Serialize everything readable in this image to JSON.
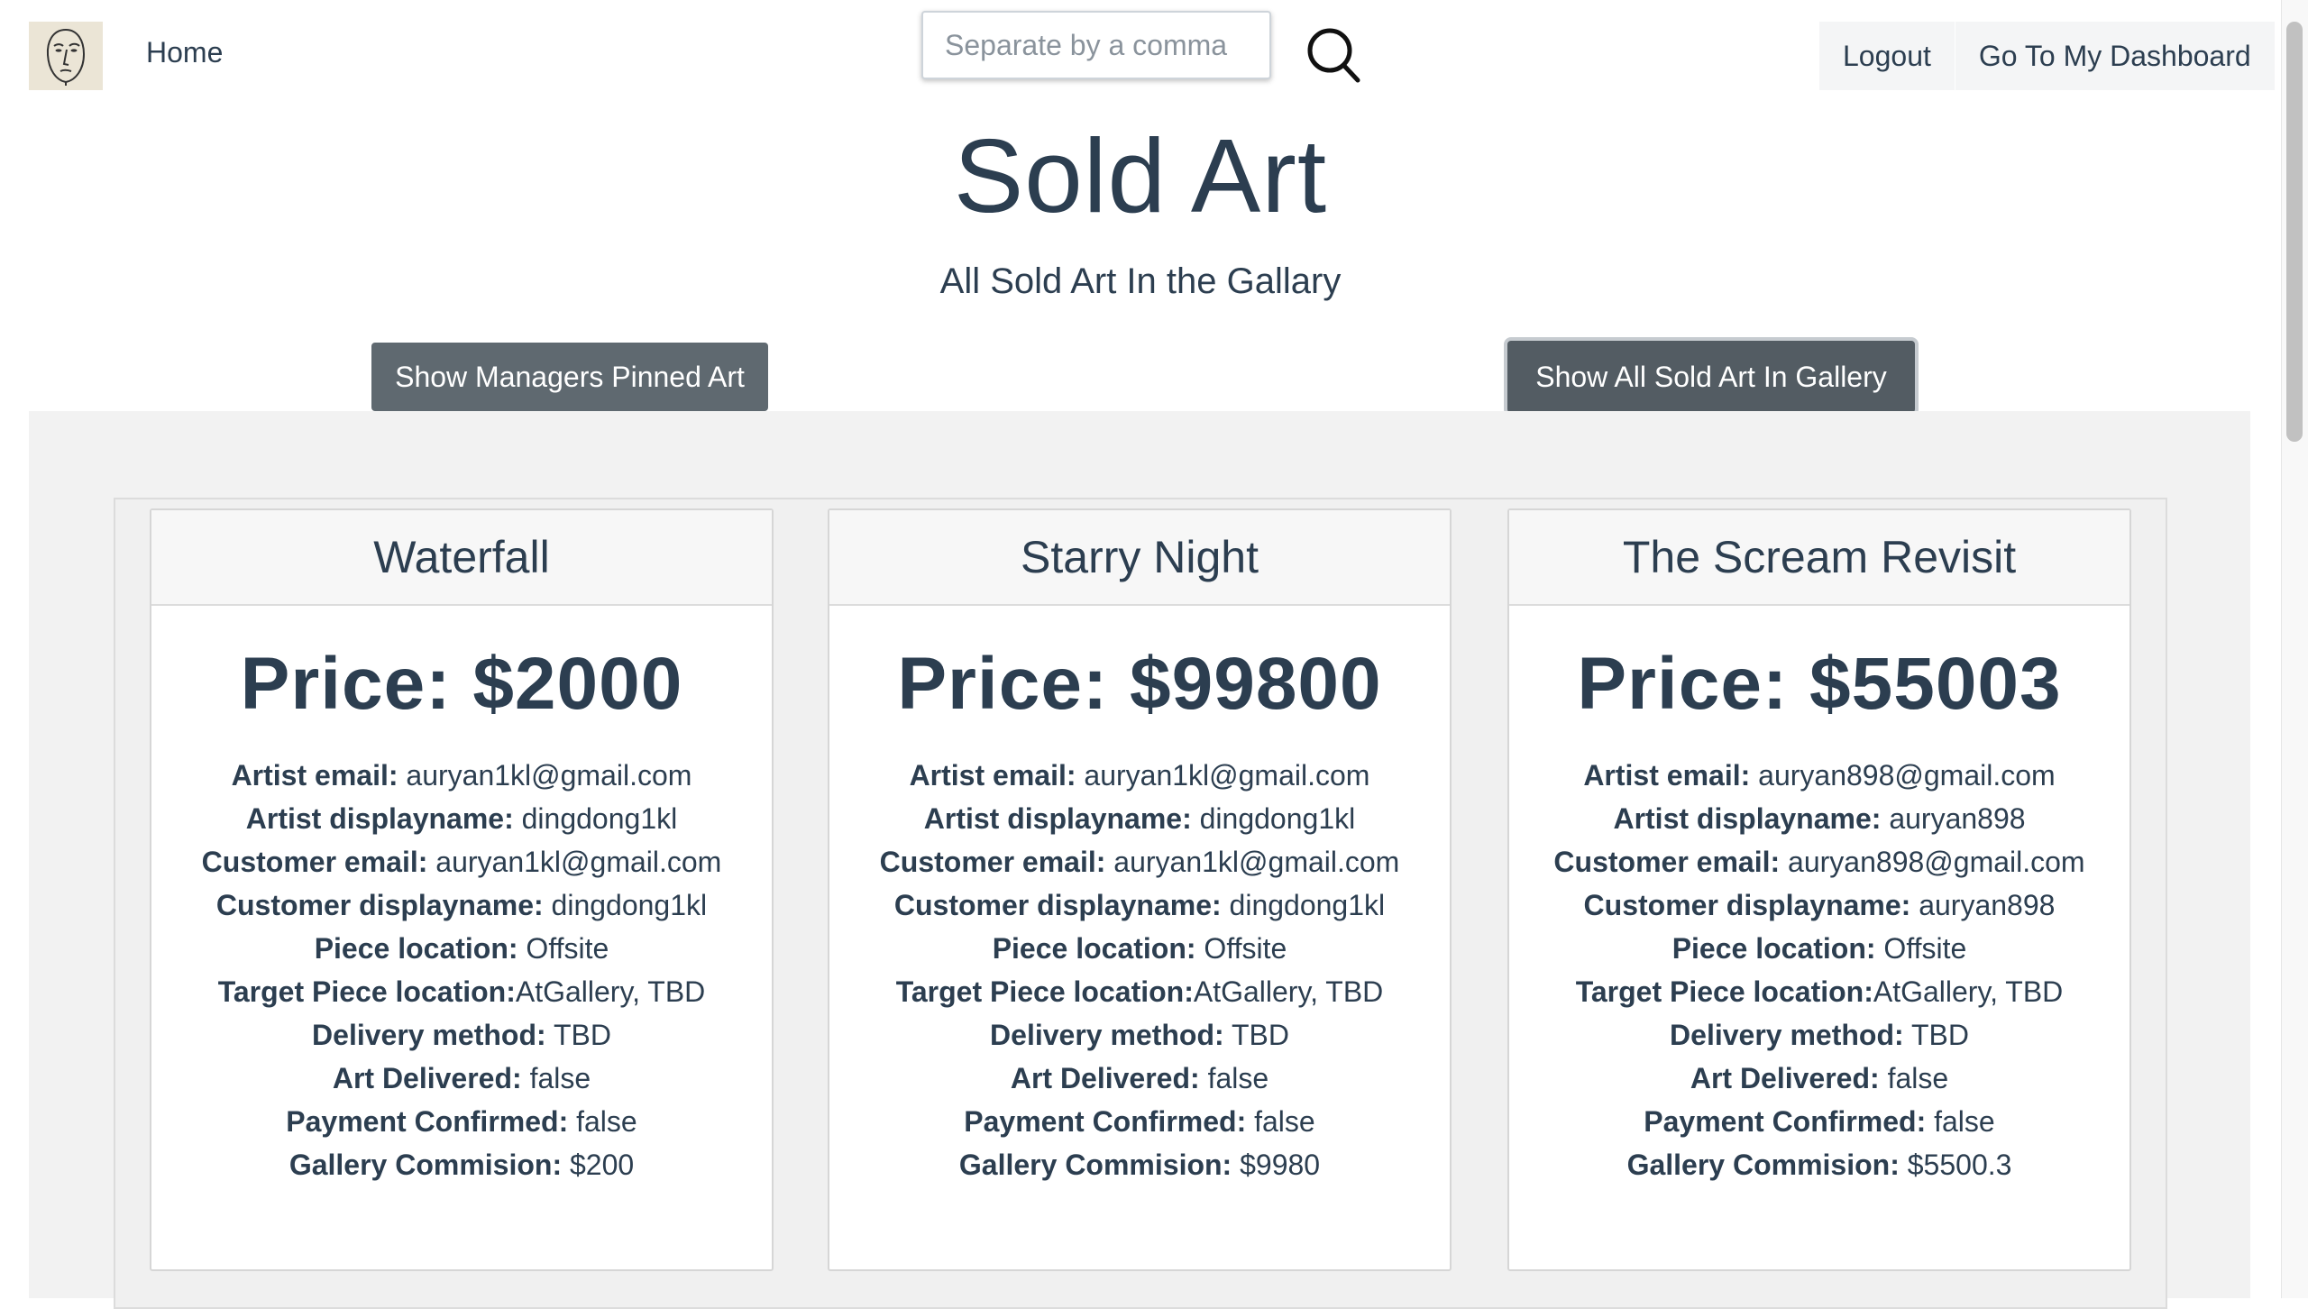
{
  "nav": {
    "home_label": "Home",
    "search_placeholder": "Separate by a comma",
    "logout_label": "Logout",
    "dashboard_label": "Go To My Dashboard"
  },
  "header": {
    "title": "Sold Art",
    "subtitle": "All Sold Art In the Gallary",
    "pinned_button": "Show Managers Pinned Art",
    "all_button": "Show All Sold Art In Gallery"
  },
  "labels": {
    "price_prefix": "Price: ",
    "artist_email": "Artist email:",
    "artist_displayname": "Artist displayname:",
    "customer_email": "Customer email:",
    "customer_displayname": "Customer displayname:",
    "piece_location": "Piece location:",
    "target_location": "Target Piece location:",
    "delivery_method": "Delivery method:",
    "art_delivered": "Art Delivered:",
    "payment_confirmed": "Payment Confirmed:",
    "gallery_commision": "Gallery Commision:"
  },
  "cards": [
    {
      "title": "Waterfall",
      "price": "$2000",
      "artist_email": "auryan1kl@gmail.com",
      "artist_displayname": "dingdong1kl",
      "customer_email": "auryan1kl@gmail.com",
      "customer_displayname": "dingdong1kl",
      "piece_location": "Offsite",
      "target_location": "AtGallery, TBD",
      "delivery_method": "TBD",
      "art_delivered": "false",
      "payment_confirmed": "false",
      "gallery_commision": "$200"
    },
    {
      "title": "Starry Night",
      "price": "$99800",
      "artist_email": "auryan1kl@gmail.com",
      "artist_displayname": "dingdong1kl",
      "customer_email": "auryan1kl@gmail.com",
      "customer_displayname": "dingdong1kl",
      "piece_location": "Offsite",
      "target_location": "AtGallery, TBD",
      "delivery_method": "TBD",
      "art_delivered": "false",
      "payment_confirmed": "false",
      "gallery_commision": "$9980"
    },
    {
      "title": "The Scream Revisit",
      "price": "$55003",
      "artist_email": "auryan898@gmail.com",
      "artist_displayname": "auryan898",
      "customer_email": "auryan898@gmail.com",
      "customer_displayname": "auryan898",
      "piece_location": "Offsite",
      "target_location": "AtGallery, TBD",
      "delivery_method": "TBD",
      "art_delivered": "false",
      "payment_confirmed": "false",
      "gallery_commision": "$5500.3"
    }
  ],
  "icons": {
    "logo": "face-sketch-icon",
    "search": "search-icon"
  },
  "colors": {
    "text": "#2c3e50",
    "button_bg": "#5f6970",
    "button_active_bg": "#535c63",
    "content_bg": "#f2f2f2"
  }
}
